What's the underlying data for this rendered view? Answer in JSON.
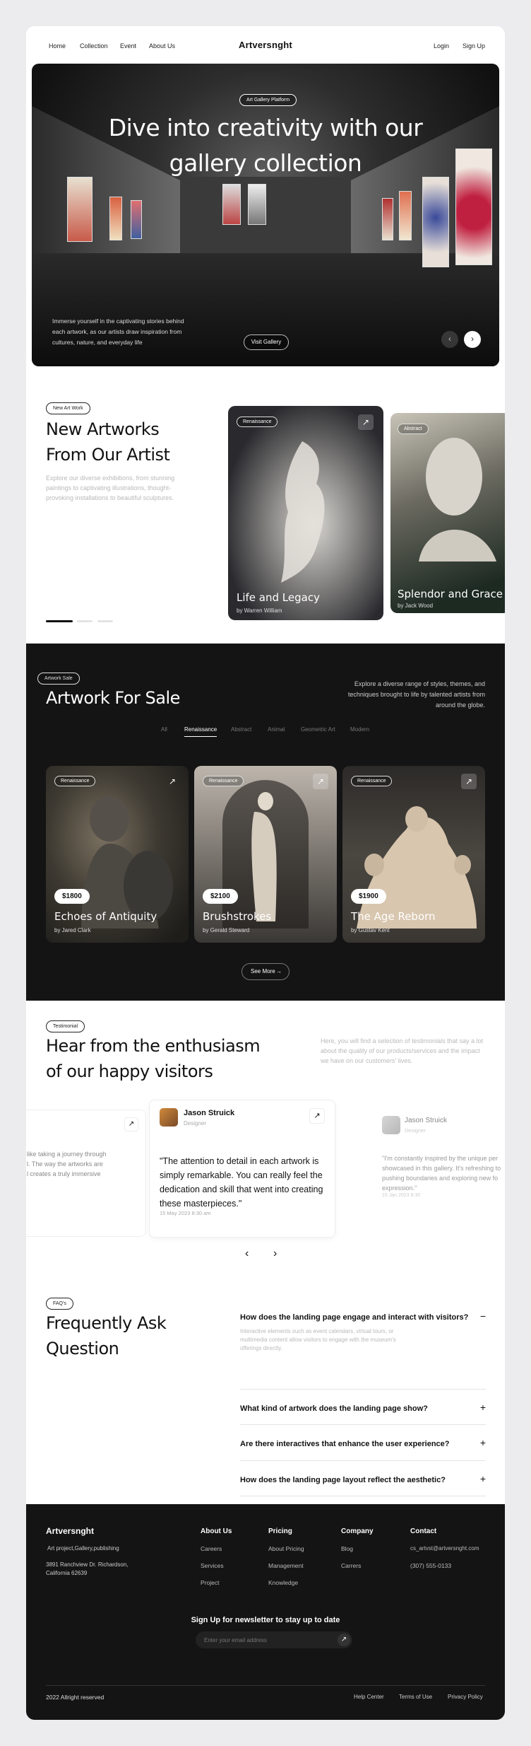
{
  "nav": {
    "links": [
      "Home",
      "Collection",
      "Event",
      "About Us"
    ],
    "brand": "Artversnght",
    "login": "Login",
    "signup": "Sign Up"
  },
  "hero": {
    "badge": "Art Gallery Platform",
    "title_line1": "Dive into creativity with our",
    "title_line2": "gallery collection",
    "description": "Immerse yourself in the captivating stories behind each artwork, as our artists draw inspiration from cultures, nature, and everyday life",
    "cta": "Visit Gallery",
    "prev_icon": "chevron-left-icon",
    "next_icon": "chevron-right-icon"
  },
  "new_artworks": {
    "badge": "New Art Work",
    "title_line1": "New Artworks",
    "title_line2": "From Our Artist",
    "description": "Explore our diverse exhibitions, from stunning paintings to captivating illustrations, thought-provoking installations to beautiful sculptures.",
    "cards": [
      {
        "tag": "Renaissance",
        "title": "Life and Legacy",
        "artist": "by Warren William"
      },
      {
        "tag": "Abstract",
        "title": "Splendor and Grace",
        "artist": "by Jack Wood"
      }
    ]
  },
  "sale": {
    "badge": "Artwork Sale",
    "title": "Artwork For Sale",
    "description": "Explore a diverse range of styles, themes, and techniques brought to life by talented artists from around the globe.",
    "tabs": [
      "All",
      "Renaissance",
      "Abstract",
      "Animal",
      "Geometric Art",
      "Modern"
    ],
    "active_tab": "Renaissance",
    "items": [
      {
        "tag": "Renaissance",
        "price": "$1800",
        "title": "Echoes of Antiquity",
        "artist": "by Jared Clark"
      },
      {
        "tag": "Renaissance",
        "price": "$2100",
        "title": "Brushstrokes",
        "artist": "by Gerald Steward"
      },
      {
        "tag": "Renaissance",
        "price": "$1900",
        "title": "The Age Reborn",
        "artist": "by Gustav Kent"
      }
    ],
    "see_more": "See More"
  },
  "testimonials": {
    "badge": "Testimonial",
    "title_line1": "Hear from the enthusiasm",
    "title_line2": "of our happy visitors",
    "description": "Here, you will find a selection of testimonials that say a lot about the quality of our products/services and the impact we have on our customers' lives.",
    "left_card_lines": [
      "like taking a journey through",
      "l. The way the artworks are",
      "l creates a truly immersive"
    ],
    "main": {
      "name": "Jason Struick",
      "role": "Designer",
      "quote": "\"The attention to detail in each artwork is simply remarkable. You can really feel the dedication and skill that went into creating these masterpieces.\"",
      "date": "15 May 2023 8:30 am"
    },
    "right": {
      "name": "Jason Struick",
      "role": "Designer",
      "quote": "\"I'm constantly inspired by the unique per showcased in this gallery. It's refreshing to pushing boundaries and exploring new fo expression.\"",
      "date": "15 Jan 2023 8:30"
    }
  },
  "faq": {
    "badge": "FAQ's",
    "title_line1": "Frequently Ask",
    "title_line2": "Question",
    "items": [
      {
        "q": "How does the landing page engage and interact with visitors?",
        "a": "Interactive elements such as event calendars, virtual tours, or multimedia content allow visitors to engage with the museum's offerings directly.",
        "open": true
      },
      {
        "q": "What kind of artwork does the landing page show?",
        "a": "",
        "open": false
      },
      {
        "q": "Are there interactives that enhance the user experience?",
        "a": "",
        "open": false
      },
      {
        "q": "How does the landing page layout reflect the aesthetic?",
        "a": "",
        "open": false
      }
    ]
  },
  "footer": {
    "brand": "Artversnght",
    "tagline": "Art project,Gallery,publishing",
    "address": "3891 Ranchview Dr. Richardson, California 62639",
    "columns": [
      {
        "title": "About Us",
        "items": [
          "Careers",
          "Services",
          "Project"
        ]
      },
      {
        "title": "Pricing",
        "items": [
          "About Pricing",
          "Management",
          "Knowledge"
        ]
      },
      {
        "title": "Company",
        "items": [
          "Blog",
          "Carrers"
        ]
      },
      {
        "title": "Contact",
        "items": [
          "cs_artvst@artversnght.com",
          "(307) 555-0133"
        ]
      }
    ],
    "newsletter_title": "Sign Up for newsletter to stay up to date",
    "newsletter_placeholder": "Enter your email address",
    "copyright": "2022  Allright reserved",
    "bottom_links": [
      "Help Center",
      "Terms of Use",
      "Privacy Policy"
    ]
  }
}
